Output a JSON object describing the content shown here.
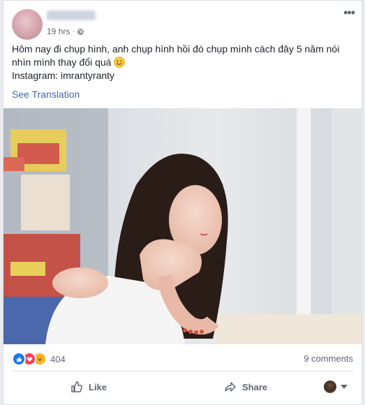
{
  "post": {
    "timestamp": "19 hrs",
    "separator": "·",
    "text_lines": [
      "Hôm nay đi chụp hình, anh chụp hình hồi đó chụp mình cách đây 5 năm nói",
      "nhìn mình thay đổi quá",
      "Instagram: imrantyranty"
    ],
    "see_translation": "See Translation"
  },
  "footer": {
    "reaction_count": "404",
    "comments": "9 comments",
    "like_label": "Like",
    "share_label": "Share"
  },
  "icons": {
    "more": "more-options-icon",
    "privacy": "globe-icon",
    "emoji": "smiley-emoji-icon",
    "like": "thumbs-up-icon",
    "share": "share-arrow-icon"
  },
  "colors": {
    "link": "#4267b2",
    "like_reaction": "#1877f2",
    "love_reaction": "#f33e58",
    "haha_reaction": "#f7b125"
  }
}
